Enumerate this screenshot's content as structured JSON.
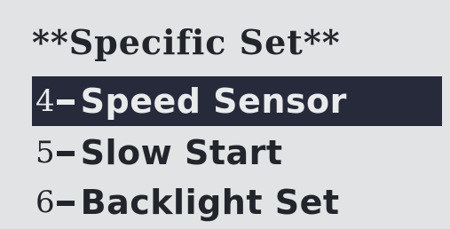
{
  "screen": {
    "title": "**Specific Set**"
  },
  "menu": {
    "items": [
      {
        "number": "4",
        "label": "Speed Sensor",
        "selected": true
      },
      {
        "number": "5",
        "label": "Slow Start",
        "selected": false
      },
      {
        "number": "6",
        "label": "Backlight Set",
        "selected": false
      }
    ]
  },
  "colors": {
    "background": "#e2e3e4",
    "text": "#23252c",
    "highlight": "#262a3a",
    "highlight_text": "#e9eaec"
  }
}
